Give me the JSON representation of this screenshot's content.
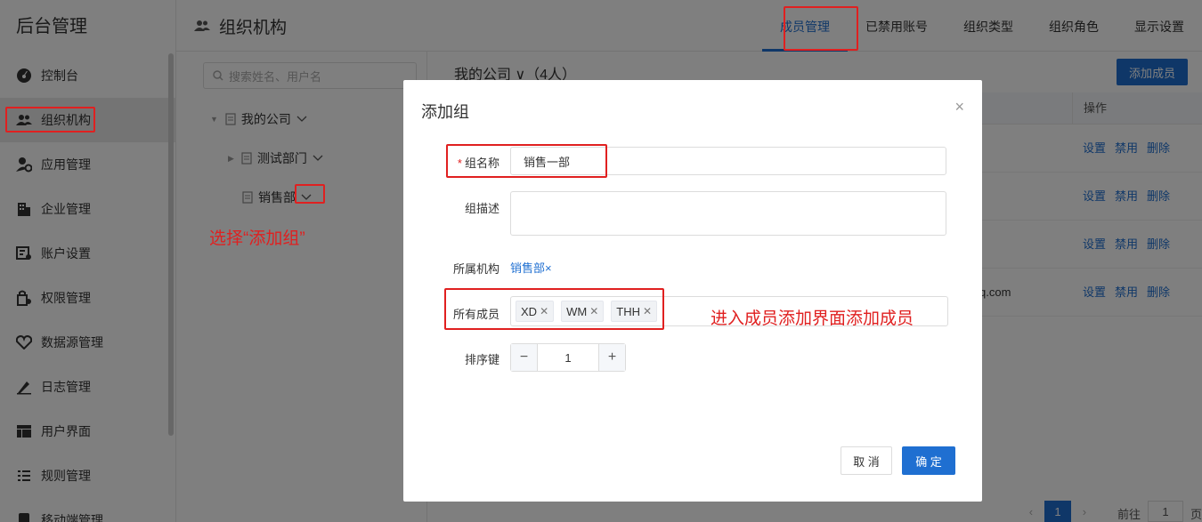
{
  "app": {
    "title": "后台管理"
  },
  "sidebar": {
    "items": [
      {
        "label": "控制台",
        "icon": "dashboard-icon"
      },
      {
        "label": "组织机构",
        "icon": "users-icon"
      },
      {
        "label": "应用管理",
        "icon": "app-settings-icon"
      },
      {
        "label": "企业管理",
        "icon": "building-icon"
      },
      {
        "label": "账户设置",
        "icon": "account-settings-icon"
      },
      {
        "label": "权限管理",
        "icon": "permission-icon"
      },
      {
        "label": "数据源管理",
        "icon": "datasource-icon"
      },
      {
        "label": "日志管理",
        "icon": "log-icon"
      },
      {
        "label": "用户界面",
        "icon": "layout-icon"
      },
      {
        "label": "规则管理",
        "icon": "rules-icon"
      },
      {
        "label": "移动端管理",
        "icon": "mobile-icon"
      }
    ]
  },
  "header": {
    "title": "组织机构",
    "tabs": [
      {
        "label": "成员管理"
      },
      {
        "label": "已禁用账号"
      },
      {
        "label": "组织类型"
      },
      {
        "label": "组织角色"
      },
      {
        "label": "显示设置"
      }
    ]
  },
  "tree": {
    "search_placeholder": "搜索姓名、用户名",
    "nodes": [
      {
        "label": "我的公司"
      },
      {
        "label": "测试部门"
      },
      {
        "label": "销售部"
      }
    ]
  },
  "main": {
    "breadcrumb": "我的公司 ∨（4人）",
    "add_button": "添加成员",
    "ops_header": "操作",
    "rows": [
      {
        "email": "",
        "ops": [
          "设置",
          "禁用",
          "删除"
        ]
      },
      {
        "email": "",
        "ops": [
          "设置",
          "禁用",
          "删除"
        ]
      },
      {
        "email": "",
        "ops": [
          "设置",
          "禁用",
          "删除"
        ]
      },
      {
        "email": "q.com",
        "ops": [
          "设置",
          "禁用",
          "删除"
        ]
      }
    ],
    "pager": {
      "prev": "‹",
      "current": "1",
      "next": "›",
      "goto_label": "前往",
      "goto_value": "1",
      "page_suffix": "页"
    }
  },
  "annotations": {
    "select_add_group": "选择“添加组”",
    "enter_member_add": "进入成员添加界面添加成员"
  },
  "dialog": {
    "title": "添加组",
    "close": "×",
    "fields": {
      "name_label": "组名称",
      "name_value": "销售一部",
      "desc_label": "组描述",
      "desc_value": "",
      "org_label": "所属机构",
      "org_value": "销售部",
      "members_label": "所有成员",
      "members": [
        "XD",
        "WM",
        "THH"
      ],
      "sort_label": "排序键",
      "sort_value": "1"
    },
    "cancel_label": "取 消",
    "ok_label": "确 定"
  },
  "colors": {
    "accent": "#1f6fd1",
    "annotation": "#e02020"
  }
}
